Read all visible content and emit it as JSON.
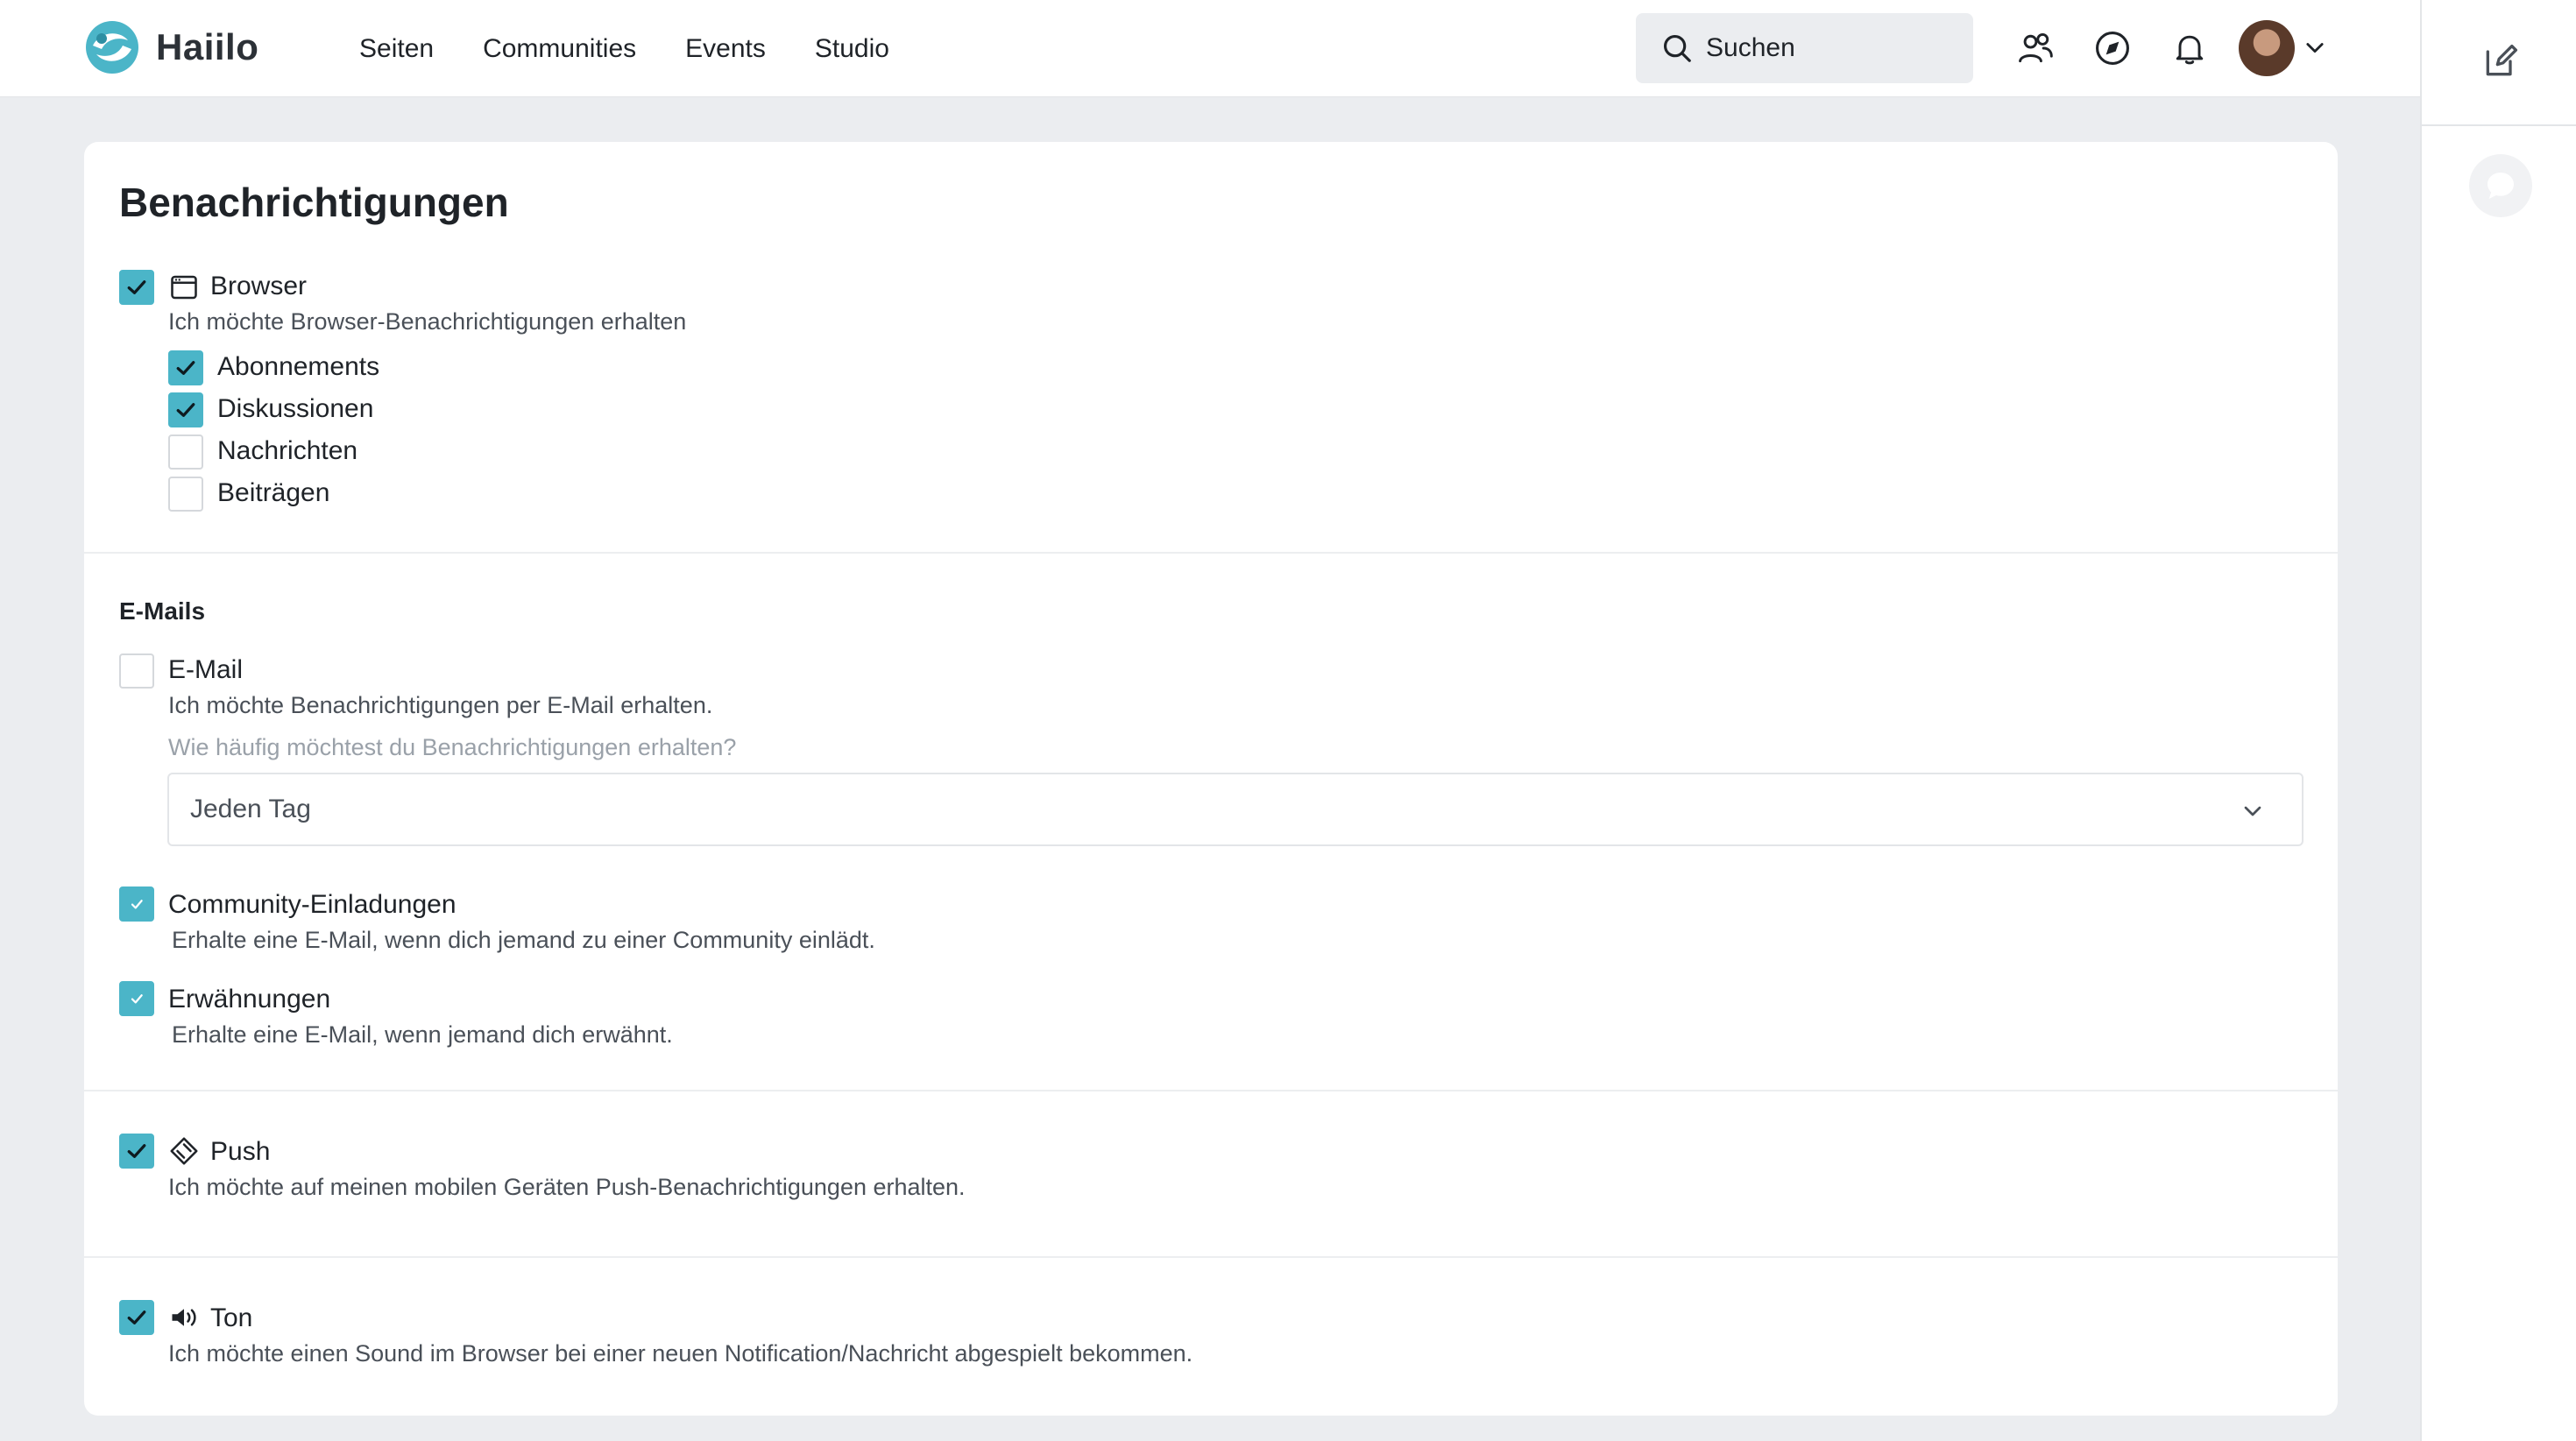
{
  "brand": {
    "name": "Haiilo",
    "accent": "#4bb5c8"
  },
  "nav": {
    "items": [
      {
        "label": "Seiten"
      },
      {
        "label": "Communities"
      },
      {
        "label": "Events"
      },
      {
        "label": "Studio"
      }
    ]
  },
  "search": {
    "placeholder": "Suchen"
  },
  "header_icons": [
    "people-icon",
    "compass-icon",
    "bell-icon",
    "avatar",
    "chevron-down-icon"
  ],
  "sidebar_icons": [
    "edit-icon",
    "chat-icon"
  ],
  "page": {
    "title": "Benachrichtigungen"
  },
  "browser": {
    "label": "Browser",
    "checked": true,
    "description": "Ich möchte Browser-Benachrichtigungen erhalten",
    "options": [
      {
        "label": "Abonnements",
        "checked": true
      },
      {
        "label": "Diskussionen",
        "checked": true
      },
      {
        "label": "Nachrichten",
        "checked": false
      },
      {
        "label": "Beiträgen",
        "checked": false
      }
    ]
  },
  "emails": {
    "heading": "E-Mails",
    "email": {
      "label": "E-Mail",
      "checked": false,
      "description": "Ich möchte Benachrichtigungen per E-Mail erhalten.",
      "frequency_question": "Wie häufig möchtest du Benachrichtigungen erhalten?",
      "frequency_value": "Jeden Tag"
    },
    "community_invites": {
      "label": "Community-Einladungen",
      "checked": true,
      "description": "Erhalte eine E-Mail, wenn dich jemand zu einer Community einlädt."
    },
    "mentions": {
      "label": "Erwähnungen",
      "checked": true,
      "description": "Erhalte eine E-Mail, wenn jemand dich erwähnt."
    }
  },
  "push": {
    "label": "Push",
    "checked": true,
    "description": "Ich möchte auf meinen mobilen Geräten Push-Benachrichtigungen erhalten."
  },
  "sound": {
    "label": "Ton",
    "checked": true,
    "description": "Ich möchte einen Sound im Browser bei einer neuen Notification/Nachricht abgespielt bekommen."
  }
}
